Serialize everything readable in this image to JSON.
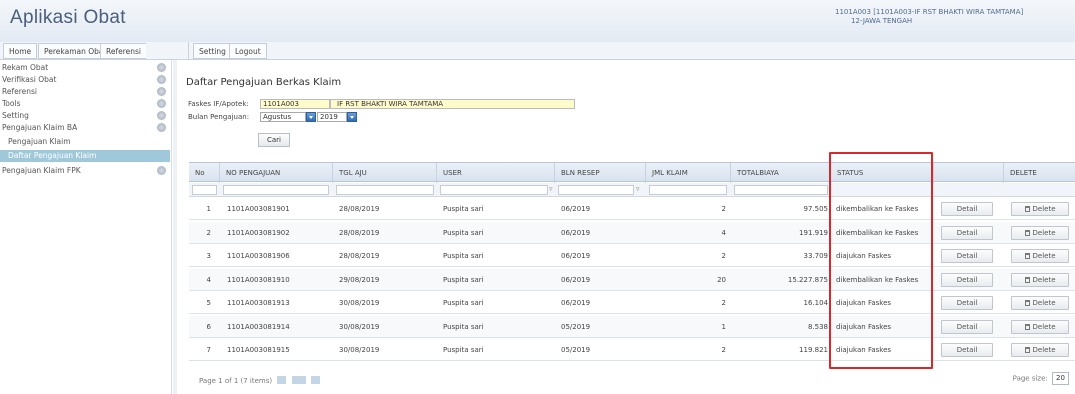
{
  "app": {
    "title": "Aplikasi Obat",
    "user_line1": "1101A003  [1101A003-IF RST BHAKTI WIRA TAMTAMA]",
    "user_line2": "12-JAWA TENGAH"
  },
  "menu": [
    "Home",
    "Perekaman Obat",
    "Referensi",
    "Setting",
    "Logout"
  ],
  "sidebar": {
    "items": [
      "Rekam Obat",
      "Verifikasi Obat",
      "Referensi",
      "Tools",
      "Setting",
      "Pengajuan Klaim BA"
    ],
    "sub_items": [
      "Pengajuan Klaim",
      "Daftar Pengajuan Klaim"
    ],
    "after_items": [
      "Pengajuan Klaim FPK"
    ]
  },
  "page": {
    "title": "Daftar Pengajuan Berkas Klaim",
    "faskes_label": "Faskes IF/Apotek:",
    "faskes_code": "1101A003",
    "faskes_name": "IF RST BHAKTI WIRA TAMTAMA",
    "bulan_label": "Bulan Pengajuan:",
    "bulan_value": "Agustus",
    "tahun_value": "2019",
    "cari_label": "Cari"
  },
  "table": {
    "columns": [
      "No",
      "NO PENGAJUAN",
      "TGL AJU",
      "USER",
      "BLN RESEP",
      "JML KLAIM",
      "TOTALBIAYA",
      "STATUS",
      "",
      "DELETE"
    ],
    "detail_label": "Detail",
    "delete_label": "Delete",
    "rows": [
      {
        "no": "1",
        "no_pengajuan": "1101A003081901",
        "tgl": "28/08/2019",
        "user": "Puspita sari",
        "bln": "06/2019",
        "jml": "2",
        "total": "97.505",
        "status": "dikembalikan ke Faskes"
      },
      {
        "no": "2",
        "no_pengajuan": "1101A003081902",
        "tgl": "28/08/2019",
        "user": "Puspita sari",
        "bln": "06/2019",
        "jml": "4",
        "total": "191.919",
        "status": "dikembalikan ke Faskes"
      },
      {
        "no": "3",
        "no_pengajuan": "1101A003081906",
        "tgl": "28/08/2019",
        "user": "Puspita sari",
        "bln": "06/2019",
        "jml": "2",
        "total": "33.709",
        "status": "diajukan Faskes"
      },
      {
        "no": "4",
        "no_pengajuan": "1101A003081910",
        "tgl": "29/08/2019",
        "user": "Puspita sari",
        "bln": "06/2019",
        "jml": "20",
        "total": "15.227.875",
        "status": "dikembalikan ke Faskes"
      },
      {
        "no": "5",
        "no_pengajuan": "1101A003081913",
        "tgl": "30/08/2019",
        "user": "Puspita sari",
        "bln": "06/2019",
        "jml": "2",
        "total": "16.104",
        "status": "diajukan Faskes"
      },
      {
        "no": "6",
        "no_pengajuan": "1101A003081914",
        "tgl": "30/08/2019",
        "user": "Puspita sari",
        "bln": "05/2019",
        "jml": "1",
        "total": "8.538",
        "status": "diajukan Faskes"
      },
      {
        "no": "7",
        "no_pengajuan": "1101A003081915",
        "tgl": "30/08/2019",
        "user": "Puspita sari",
        "bln": "05/2019",
        "jml": "2",
        "total": "119.821",
        "status": "diajukan Faskes"
      }
    ],
    "pager_text": "Page 1 of 1 (7 items)",
    "page_size_label": "Page size:",
    "page_size_value": "20"
  },
  "colors": {
    "header_bg": "#e3eaf3",
    "active_sidebar": "#9fc9da",
    "highlight_box": "#d8282b",
    "input_highlight": "#fffccc"
  }
}
